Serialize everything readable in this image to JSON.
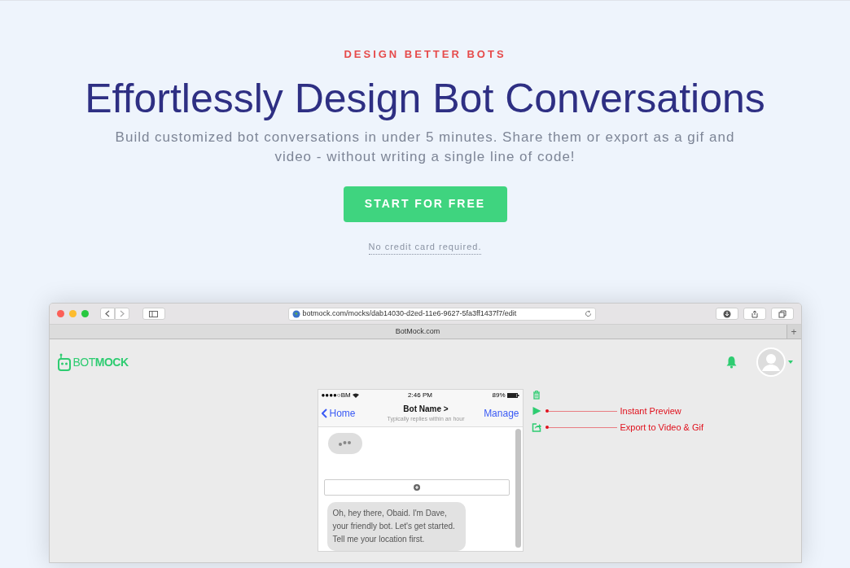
{
  "hero": {
    "eyebrow": "DESIGN BETTER BOTS",
    "title": "Effortlessly Design Bot Conversations",
    "subtitle": "Build customized bot conversations in under 5 minutes. Share them or export as a gif and video - without writing a single line of code!",
    "cta": "START FOR FREE",
    "note": "No credit card required."
  },
  "browser": {
    "url": "botmock.com/mocks/dab14030-d2ed-11e6-9627-5fa3ff1437f7/edit",
    "tab": "BotMock.com",
    "new_tab": "+"
  },
  "app": {
    "logo_prefix": "BOT",
    "logo_suffix": "MOCK"
  },
  "phone": {
    "carrier": "●●●●○BM",
    "time": "2:46 PM",
    "battery": "89%",
    "back": "Home",
    "bot_name": "Bot Name >",
    "bot_status": "Typically replies within an hour",
    "action": "Manage",
    "messages": [
      {
        "kind": "typing"
      },
      {
        "kind": "add"
      },
      {
        "kind": "text",
        "text": "Oh, hey there, Obaid. I'm Dave, your friendly bot. Let's get started. Tell me your location first."
      }
    ]
  },
  "tools": [
    {
      "kind": "trash"
    },
    {
      "kind": "play",
      "annotation": "Instant Preview"
    },
    {
      "kind": "export",
      "annotation": "Export to Video & Gif"
    }
  ]
}
